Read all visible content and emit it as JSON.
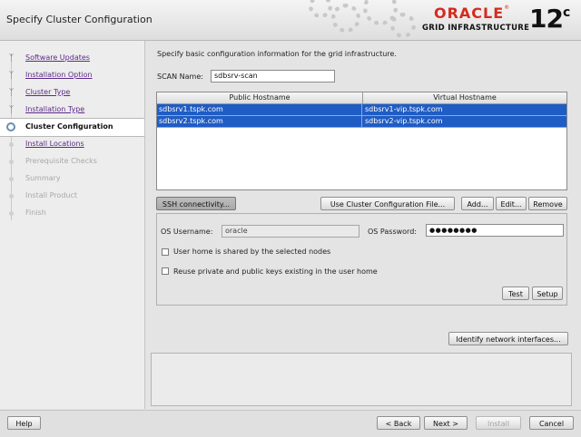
{
  "window": {
    "title": "Specify Cluster Configuration"
  },
  "branding": {
    "oracle": "ORACLE",
    "product": "GRID INFRASTRUCTURE",
    "version": "12",
    "version_sup": "c"
  },
  "nav": {
    "steps": [
      {
        "label": "Software Updates",
        "state": "done"
      },
      {
        "label": "Installation Option",
        "state": "done"
      },
      {
        "label": "Cluster Type",
        "state": "done"
      },
      {
        "label": "Installation Type",
        "state": "done"
      },
      {
        "label": "Cluster Configuration",
        "state": "current"
      },
      {
        "label": "Install Locations",
        "state": "next"
      },
      {
        "label": "Prerequisite Checks",
        "state": "todo"
      },
      {
        "label": "Summary",
        "state": "todo"
      },
      {
        "label": "Install Product",
        "state": "todo"
      },
      {
        "label": "Finish",
        "state": "todo"
      }
    ]
  },
  "main": {
    "intro": "Specify basic configuration information for the grid infrastructure.",
    "scan_label": "SCAN Name:",
    "scan_value": "sdbsrv-scan",
    "table": {
      "headers": [
        "Public Hostname",
        "Virtual Hostname"
      ],
      "rows": [
        [
          "sdbsrv1.tspk.com",
          "sdbsrv1-vip.tspk.com"
        ],
        [
          "sdbsrv2.tspk.com",
          "sdbsrv2-vip.tspk.com"
        ]
      ]
    },
    "buttons": {
      "ssh": "SSH connectivity...",
      "use_config_file": "Use Cluster Configuration File...",
      "add": "Add...",
      "edit": "Edit...",
      "remove": "Remove"
    },
    "ssh": {
      "username_label": "OS Username:",
      "username_value": "oracle",
      "password_label": "OS Password:",
      "password_value": "●●●●●●●●",
      "shared_home_label": "User home is shared by the selected nodes",
      "reuse_keys_label": "Reuse private and public keys existing in the user home",
      "test": "Test",
      "setup": "Setup"
    },
    "identify_interfaces": "Identify network interfaces..."
  },
  "footer": {
    "help": "Help",
    "back": "< Back",
    "next": "Next >",
    "install": "Install",
    "cancel": "Cancel"
  },
  "colors": {
    "selection": "#1f5cc4",
    "oracle_red": "#d52b1e",
    "nav_link": "#5c2a8a"
  }
}
